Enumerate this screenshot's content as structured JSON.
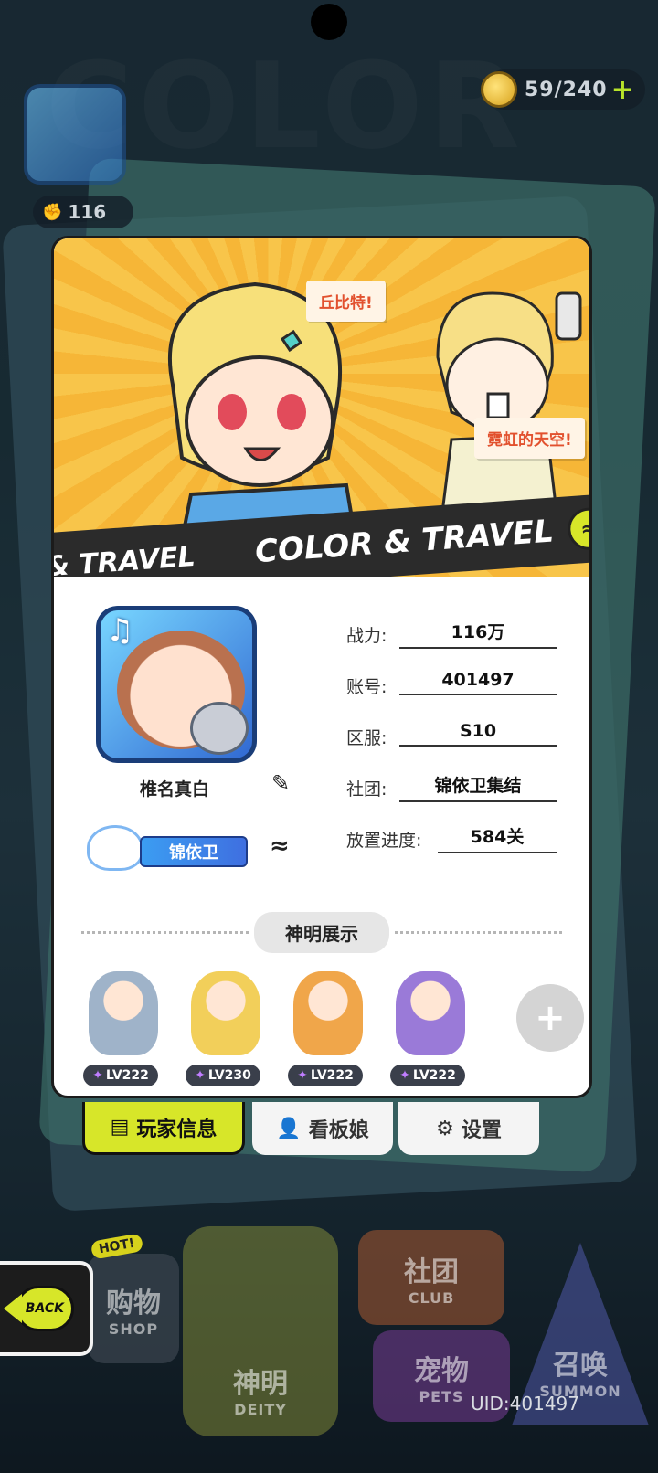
{
  "top": {
    "energy": "59/240",
    "energy_plus": "+",
    "power_short": "116"
  },
  "banner": {
    "bubble1": "丘比特!",
    "bubble2": "霓虹的天空!",
    "stripe_left": "& TRAVEL",
    "stripe_main": "COLOR & TRAVEL",
    "stripe_logo": "≈"
  },
  "player": {
    "name": "椎名真白",
    "club_tag": "锦依卫"
  },
  "stats": [
    {
      "label": "战力:",
      "value": "116万"
    },
    {
      "label": "账号:",
      "value": "401497"
    },
    {
      "label": "区服:",
      "value": "S10"
    },
    {
      "label": "社团:",
      "value": "锦依卫集结"
    },
    {
      "label": "放置进度:",
      "value": "584关"
    }
  ],
  "deity_section": {
    "title": "神明展示",
    "deities": [
      {
        "level": "LV222",
        "color": "#9fb3c9"
      },
      {
        "level": "LV230",
        "color": "#f2cf5a"
      },
      {
        "level": "LV222",
        "color": "#f0a64a"
      },
      {
        "level": "LV222",
        "color": "#9a7ad8"
      }
    ],
    "add_label": "+"
  },
  "tabs": [
    {
      "label": "玩家信息",
      "icon": "profile-icon"
    },
    {
      "label": "看板娘",
      "icon": "person-swap-icon"
    },
    {
      "label": "设置",
      "icon": "gear-icon"
    }
  ],
  "bottom_menu": {
    "hot": "HOT!",
    "shop_cn": "购物",
    "shop_en": "SHOP",
    "deity_cn": "神明",
    "deity_en": "DEITY",
    "club_cn": "社团",
    "club_en": "CLUB",
    "pets_cn": "宠物",
    "pets_en": "PETS",
    "summon_cn": "召唤",
    "summon_en": "SUMMON"
  },
  "back_label": "BACK",
  "uid": "UID:401497",
  "colors": {
    "accent": "#d7e629",
    "card_bg": "#ffffff",
    "banner_yellow": "#f8c54a"
  }
}
